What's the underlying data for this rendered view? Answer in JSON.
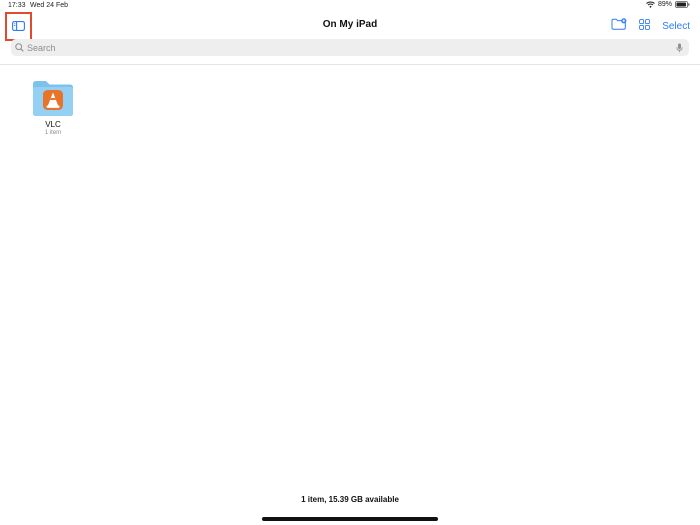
{
  "status_bar": {
    "time": "17:33",
    "date": "Wed 24 Feb",
    "battery": "89%"
  },
  "nav": {
    "title": "On My iPad",
    "select_label": "Select"
  },
  "search": {
    "placeholder": "Search",
    "value": ""
  },
  "files": [
    {
      "name": "VLC",
      "meta": "1 item",
      "icon": "vlc-cone-icon"
    }
  ],
  "footer": {
    "storage": "1 item, 15.39 GB available"
  },
  "colors": {
    "accent": "#2f7cf6",
    "highlight_box": "#e04a2e",
    "folder": "#8fcdf1",
    "vlc_orange": "#e8742a"
  }
}
